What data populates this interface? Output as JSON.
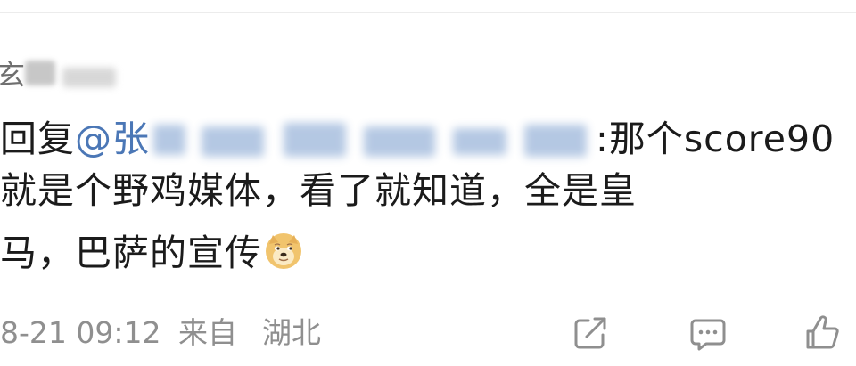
{
  "comment": {
    "username_visible": "玄",
    "reply_prefix": "回复",
    "mention_at": "@张",
    "mention_tail": ":那个score90",
    "line2": "就是个野鸡媒体，看了就知道，全是皇",
    "line3": "马，巴萨的宣传",
    "emoji": "doge-emoji"
  },
  "meta": {
    "time": "8-21 09:12",
    "from_label": "来自",
    "location": "湖北"
  },
  "actions": {
    "share_icon": "share-icon",
    "comment_icon": "comment-icon",
    "like_icon": "like-icon"
  },
  "colors": {
    "mention": "#4b77b6",
    "text": "#1b1b1b",
    "meta": "#8f8f8f"
  }
}
